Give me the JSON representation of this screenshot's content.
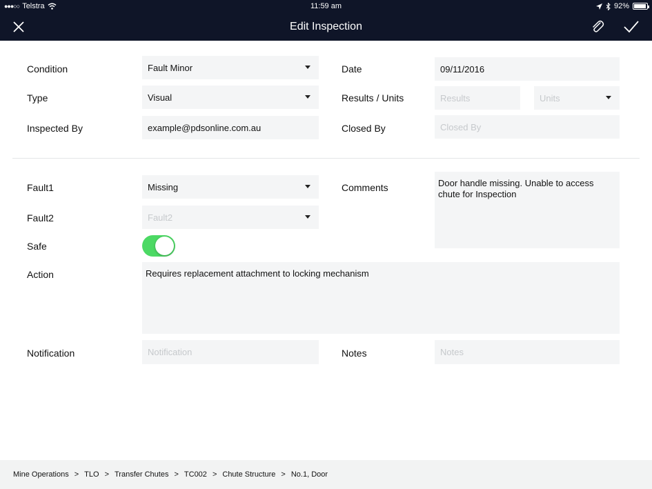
{
  "status": {
    "carrier": "Telstra",
    "time": "11:59 am",
    "battery": "92%",
    "battery_level": 0.92
  },
  "nav": {
    "title": "Edit Inspection"
  },
  "form": {
    "condition": {
      "label": "Condition",
      "value": "Fault Minor"
    },
    "type": {
      "label": "Type",
      "value": "Visual"
    },
    "inspected_by": {
      "label": "Inspected By",
      "value": "example@pdsonline.com.au"
    },
    "date": {
      "label": "Date",
      "value": "09/11/2016"
    },
    "results_units": {
      "label": "Results / Units",
      "results_placeholder": "Results",
      "units_placeholder": "Units"
    },
    "closed_by": {
      "label": "Closed By",
      "placeholder": "Closed By"
    },
    "fault1": {
      "label": "Fault1",
      "value": "Missing"
    },
    "fault2": {
      "label": "Fault2",
      "placeholder": "Fault2"
    },
    "safe": {
      "label": "Safe",
      "on": true
    },
    "comments": {
      "label": "Comments",
      "value": "Door handle missing. Unable to access chute for Inspection"
    },
    "action": {
      "label": "Action",
      "value": "Requires replacement attachment to locking mechanism"
    },
    "notification": {
      "label": "Notification",
      "placeholder": "Notification"
    },
    "notes": {
      "label": "Notes",
      "placeholder": "Notes"
    }
  },
  "breadcrumb": {
    "separator": ">",
    "items": [
      "Mine Operations",
      "TLO",
      "Transfer Chutes",
      "TC002",
      "Chute Structure",
      "No.1, Door"
    ]
  }
}
